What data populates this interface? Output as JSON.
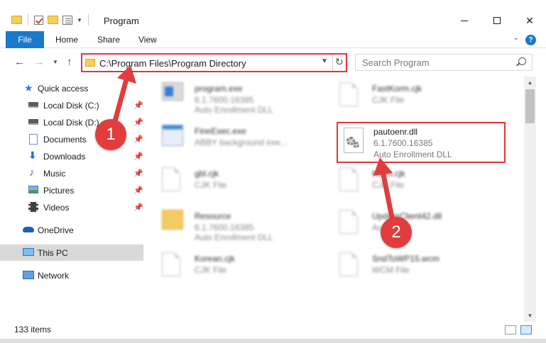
{
  "window": {
    "title": "Program",
    "controls": {
      "minimize": "minimize",
      "maximize": "maximize",
      "close": "✕"
    }
  },
  "ribbon": {
    "tabs": [
      "File",
      "Home",
      "Share",
      "View"
    ],
    "help": "?"
  },
  "address": {
    "path": "C:\\Program Files\\Program Directory",
    "search_placeholder": "Search Program"
  },
  "sidebar": {
    "items": [
      {
        "label": "Quick access",
        "icon": "star-icon",
        "pinned": false
      },
      {
        "label": "Local Disk (C:)",
        "icon": "drive-icon",
        "pinned": true
      },
      {
        "label": "Local Disk (D:)",
        "icon": "drive-icon",
        "pinned": true
      },
      {
        "label": "Documents",
        "icon": "documents-icon",
        "pinned": true
      },
      {
        "label": "Downloads",
        "icon": "download-icon",
        "pinned": true
      },
      {
        "label": "Music",
        "icon": "music-icon",
        "pinned": true
      },
      {
        "label": "Pictures",
        "icon": "pictures-icon",
        "pinned": true
      },
      {
        "label": "Videos",
        "icon": "videos-icon",
        "pinned": true
      },
      {
        "label": "OneDrive",
        "icon": "cloud-icon",
        "pinned": false
      },
      {
        "label": "This PC",
        "icon": "computer-icon",
        "pinned": false
      },
      {
        "label": "Network",
        "icon": "network-icon",
        "pinned": false
      }
    ]
  },
  "files": [
    {
      "name": "program.exe",
      "meta1": "6.1.7600.16385",
      "meta2": "Auto Enrollment DLL",
      "icon": "exe-icon"
    },
    {
      "name": "FastKorm.cjk",
      "meta1": "CJK File",
      "meta2": "",
      "icon": "document-icon"
    },
    {
      "name": "FineExec.exe",
      "meta1": "ABBY background exe...",
      "meta2": "",
      "icon": "exe-icon"
    },
    {
      "name": "pautoenr.dll",
      "meta1": "6.1.7600.16385",
      "meta2": "Auto Enrollment DLL",
      "icon": "gear-document-icon"
    },
    {
      "name": "gbl.cjk",
      "meta1": "CJK File",
      "meta2": "",
      "icon": "document-icon"
    },
    {
      "name": "Korm.cjk",
      "meta1": "CJK File",
      "meta2": "",
      "icon": "document-icon"
    },
    {
      "name": "Resource",
      "meta1": "6.1.7600.16385",
      "meta2": "Auto Enrollment DLL",
      "icon": "folder-icon"
    },
    {
      "name": "UpdateClient42.dll",
      "meta1": "Auto...DLL",
      "meta2": "",
      "icon": "gear-document-icon"
    },
    {
      "name": "Korean.cjk",
      "meta1": "CJK File",
      "meta2": "",
      "icon": "document-icon"
    },
    {
      "name": "SndToWP15.wcm",
      "meta1": "WCM File",
      "meta2": "",
      "icon": "document-icon"
    }
  ],
  "status": {
    "count": "133 items"
  },
  "annotations": {
    "step1": "1",
    "step2": "2",
    "color": "#e23c3c"
  }
}
